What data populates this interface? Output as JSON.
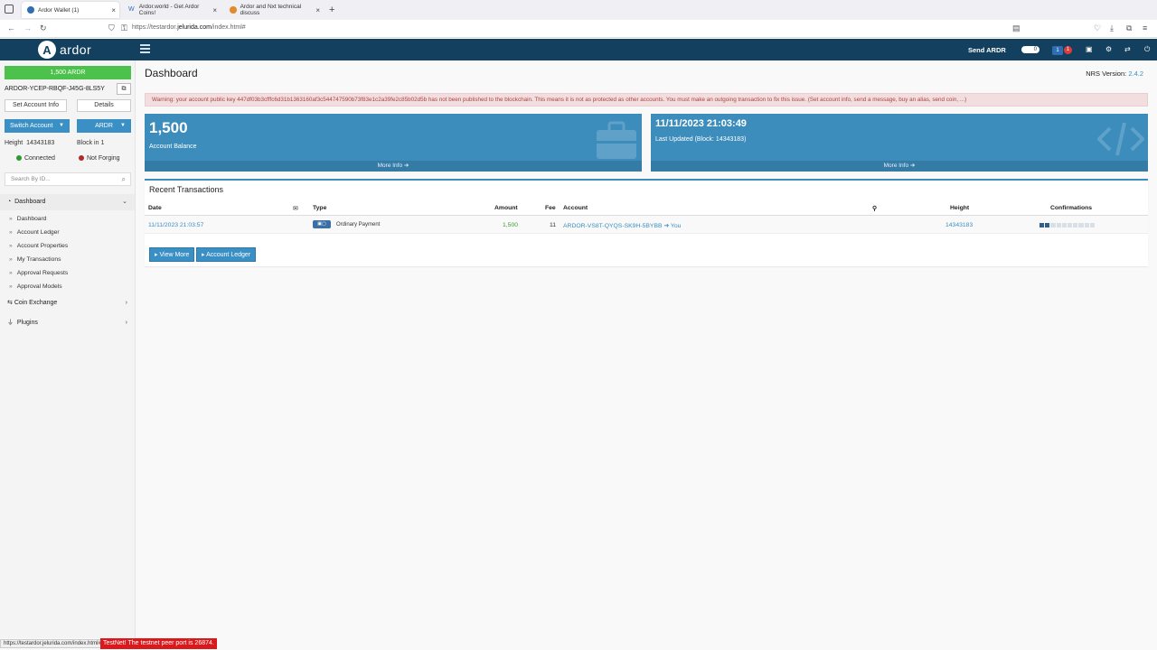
{
  "browser": {
    "tabs": [
      {
        "label": "Ardor Wallet (1)",
        "active": true
      },
      {
        "label": "Ardor.world - Get Ardor Coins!",
        "active": false
      },
      {
        "label": "Ardor and Nxt technical discuss",
        "active": false
      }
    ],
    "url_prefix": "https://testardor.",
    "url_domain": "jelurida.com",
    "url_path": "/index.html#"
  },
  "header": {
    "logo_text": "ardor",
    "send_label": "Send ARDR",
    "toggle_value": "0",
    "badge_blue": "1",
    "badge_red": "1"
  },
  "sidebar": {
    "balance_button": "1,500  ARDR",
    "account_id": "ARDOR-YCEP-RBQF-J45G-8LS5Y",
    "set_account_info": "Set Account Info",
    "details": "Details",
    "switch_account": "Switch Account",
    "currency": "ARDR",
    "height_label": "Height",
    "height_value": "14343183",
    "block_in": "Block in 1",
    "connected": "Connected",
    "not_forging": "Not Forging",
    "search_placeholder": "Search By ID...",
    "dashboard_section": "Dashboard",
    "items": [
      "Dashboard",
      "Account Ledger",
      "Account Properties",
      "My Transactions",
      "Approval Requests",
      "Approval Models"
    ],
    "coin_exchange": "Coin Exchange",
    "plugins": "Plugins"
  },
  "main": {
    "title": "Dashboard",
    "nrs_label": "NRS Version:",
    "nrs_version": "2.4.2",
    "warning": "Warning: your account public key 447df03b3cfffc6d31b1363160af3c544747590b73f83e1c2a39fe2c85b02d5b has not been published to the blockchain. This means it is not as protected as other accounts. You must make an outgoing transaction to fix this issue. (Set account info, send a message, buy an alias, send coin, ...)",
    "card_balance": {
      "value": "1,500",
      "label": "Account Balance",
      "more": "More Info"
    },
    "card_update": {
      "value": "11/11/2023 21:03:49",
      "label": "Last Updated (Block: 14343183)",
      "more": "More Info"
    },
    "recent": {
      "title": "Recent Transactions",
      "columns": {
        "date": "Date",
        "type": "Type",
        "amount": "Amount",
        "fee": "Fee",
        "account": "Account",
        "height": "Height",
        "confirmations": "Confirmations"
      },
      "rows": [
        {
          "date": "11/11/2023 21:03:57",
          "type": "Ordinary Payment",
          "amount": "1,500",
          "fee": "11",
          "account": "ARDOR-VS8T-QYQS-SK9H-5BYBB",
          "you": "You",
          "height": "14343183",
          "confirmations_filled": 2,
          "confirmations_total": 10
        }
      ],
      "view_more": "View More",
      "account_ledger": "Account Ledger"
    }
  },
  "footer": {
    "status_url": "https://testardor.jelurida.com/index.html#",
    "testnet_note": "TestNet! The testnet peer port is 26874."
  },
  "colors": {
    "header": "#13405f",
    "accent": "#3c8dbc",
    "balance_green": "#4cc14c",
    "warning_bg": "#f2dede",
    "testnet_red": "#d9191c"
  }
}
